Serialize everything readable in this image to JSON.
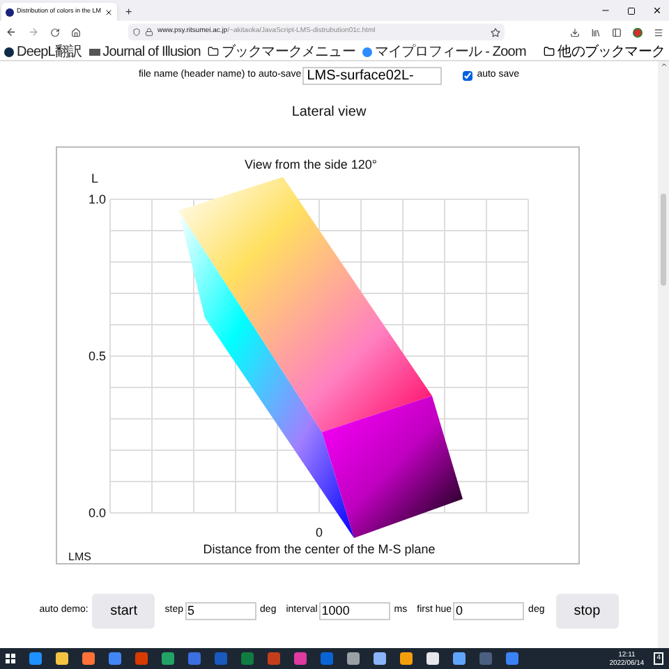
{
  "browser": {
    "tab_title": "Distribution of colors in the LM",
    "new_tab": "+",
    "url_host": "www.psy.ritsumei.ac.jp",
    "url_path": "/~akitaoka/JavaScript-LMS-distrubution01c.html",
    "bookmarks": [
      {
        "label": "DeepL翻訳",
        "kind": "logo"
      },
      {
        "label": "Journal of Illusion",
        "kind": "pdf"
      },
      {
        "label": "ブックマークメニュー",
        "kind": "folder"
      },
      {
        "label": "マイプロフィール - Zoom",
        "kind": "zoom"
      }
    ],
    "other_bookmarks": "他のブックマーク"
  },
  "save": {
    "label": "file name (header name) to auto-save",
    "value": "LMS-surface02L-",
    "auto_save_label": "auto save",
    "auto_save_checked": true
  },
  "heading": "Lateral view",
  "plot": {
    "title": "View from the side 120°",
    "y_axis_label": "L",
    "y_ticks": [
      "1.0",
      "0.5",
      "0.0"
    ],
    "x_tick": "0",
    "x_axis_label": "Distance from the center of the M-S plane",
    "corner_label": "LMS"
  },
  "demo": {
    "label": "auto demo:",
    "start": "start",
    "fields": [
      {
        "label": "step",
        "value": "5",
        "unit": "deg"
      },
      {
        "label": "interval",
        "value": "1000",
        "unit": "ms"
      },
      {
        "label": "first hue",
        "value": "0",
        "unit": "deg"
      }
    ],
    "stop": "stop"
  },
  "taskbar": {
    "time": "12:11",
    "date": "2022/06/14",
    "notifications": "4"
  }
}
